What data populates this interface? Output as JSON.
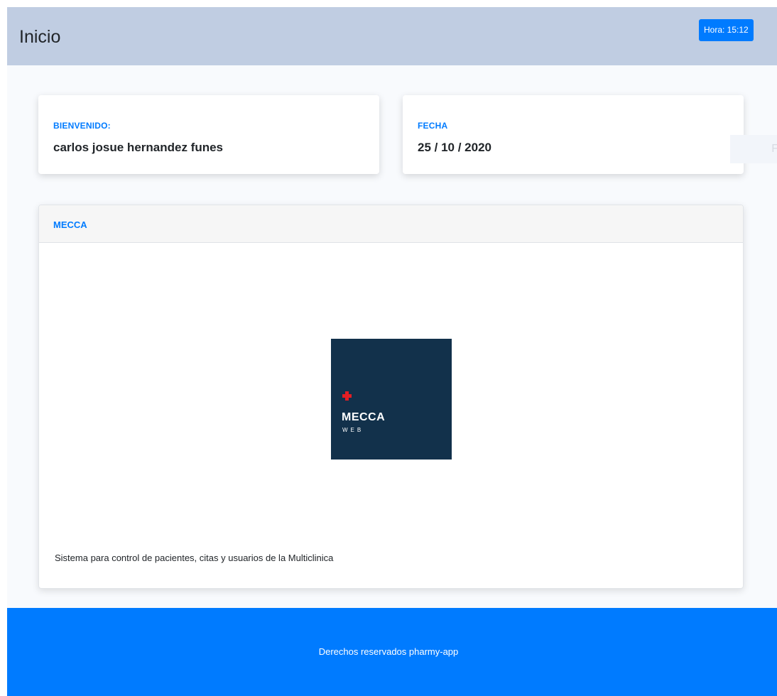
{
  "header": {
    "title": "Inicio",
    "time_badge": "Hora: 15:12"
  },
  "welcome_card": {
    "label": "BIENVENIDO:",
    "value": "carlos josue hernandez funes"
  },
  "date_card": {
    "label": "FECHA",
    "value": "25 / 10 / 2020"
  },
  "ghost": {
    "letter": "F"
  },
  "main_card": {
    "title": "MECCA",
    "logo_title": "MECCA",
    "logo_subtitle": "WEB",
    "description": "Sistema para control de pacientes, citas y usuarios de la Multiclinica"
  },
  "footer": {
    "text": "Derechos reservados pharmy-app"
  },
  "colors": {
    "header_bg": "#c0cde2",
    "accent": "#007bff",
    "logo_bg": "#12314b",
    "logo_cross": "#e31e24"
  }
}
